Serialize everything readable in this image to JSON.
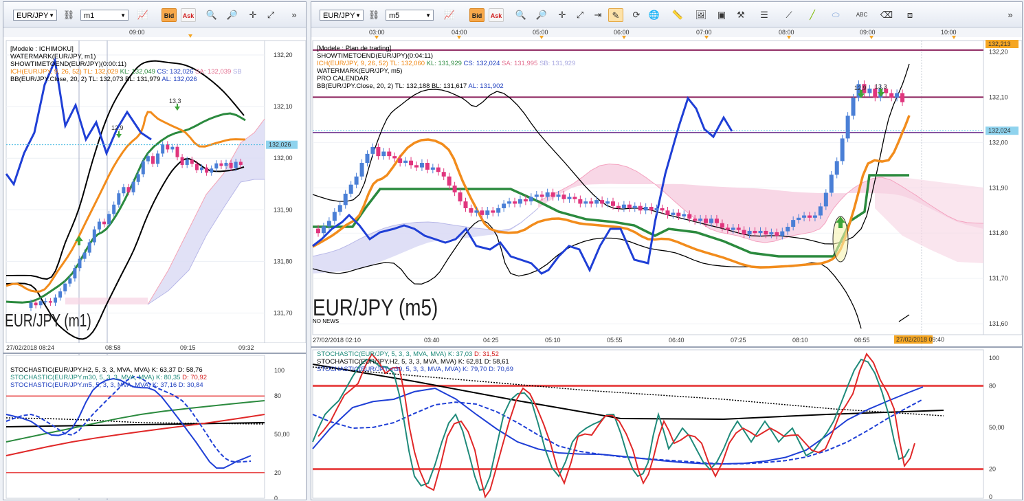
{
  "left": {
    "toolbar": {
      "symbol": "EUR/JPY",
      "timeframe": "m1",
      "bid_label": "Bid",
      "ask_label": "Ask"
    },
    "top_time_labels": [
      "09:00"
    ],
    "legend": [
      {
        "text": "[Modele : ICHIMOKU]",
        "color": "#000000"
      },
      {
        "text": "WATERMARK(EUR/JPY, m1)",
        "color": "#000000"
      },
      {
        "text": "SHOWTIMETOEND(EUR/JPY)(0:00:11)",
        "color": "#000000"
      },
      {
        "text": "ICH(EUR/JPY, 9, 26, 52)  TL: 132,029",
        "color": "#f0850f"
      },
      {
        "text": "KL: 132,049",
        "color": "#2b8a3e"
      },
      {
        "text": "CS: 132,026",
        "color": "#1f3fbf"
      },
      {
        "text": "SA: 132,039",
        "color": "#e26d8e"
      },
      {
        "text": "SB",
        "color": "#a8a8e0"
      },
      {
        "text": "BB(EUR/JPY.Close, 20, 2)  TL: 132,073  BL: 131,979",
        "color": "#000000"
      },
      {
        "text": "AL: 132,026",
        "color": "#1f3fbf"
      }
    ],
    "price_labels": [
      "132,20",
      "132,10",
      "132,00",
      "131,90",
      "131,80",
      "131,70"
    ],
    "current_price": "132,026",
    "watermark": "EUR/JPY (m1)",
    "time_labels": [
      "27/02/2018 08:24",
      "08:58",
      "09:15",
      "09:32"
    ],
    "annotations": [
      "12,9",
      "13,3"
    ],
    "stoch_legend": [
      {
        "text": "STOCHASTIC(EUR/JPY.H2, 5, 3, 3, MVA, MVA)  K: 63,37  D: 58,76",
        "color": "#000000"
      },
      {
        "text": "STOCHASTIC(EUR/JPY.m30, 5, 3, 3, MVA, MVA)  K: 80,35",
        "color": "#1f8a7a"
      },
      {
        "text": "D: 70,92",
        "color": "#d42020"
      },
      {
        "text": "STOCHASTIC(EUR/JPY.m5, 5, 3, 3, MVA, MVA)  K: 37,16  D: 30,84",
        "color": "#1f3fbf"
      }
    ],
    "stoch_levels": [
      "100",
      "80",
      "50,00",
      "20",
      "0"
    ]
  },
  "right": {
    "toolbar": {
      "symbol": "EUR/JPY",
      "timeframe": "m5",
      "bid_label": "Bid",
      "ask_label": "Ask"
    },
    "top_time_labels": [
      "03:00",
      "04:00",
      "05:00",
      "06:00",
      "07:00",
      "08:00",
      "09:00",
      "10:00"
    ],
    "legend": [
      {
        "text": "[Modele : Plan de trading]",
        "color": "#000000"
      },
      {
        "text": "SHOWTIMETOEND(EUR/JPY)(0:04:11)",
        "color": "#000000"
      },
      {
        "text": "ICH(EUR/JPY, 9, 26, 52)  TL: 132,060",
        "color": "#f0850f"
      },
      {
        "text": "KL: 131,929",
        "color": "#2b8a3e"
      },
      {
        "text": "CS: 132,024",
        "color": "#1f3fbf"
      },
      {
        "text": "SA: 131,995",
        "color": "#e26d8e"
      },
      {
        "text": "SB: 131,929",
        "color": "#a8a8e0"
      },
      {
        "text": "WATERMARK(EUR/JPY, m5)",
        "color": "#000000"
      },
      {
        "text": "PRO CALENDAR",
        "color": "#000000"
      },
      {
        "text": "BB(EUR/JPY.Close, 20, 2)  TL: 132,188  BL: 131,617",
        "color": "#000000"
      },
      {
        "text": "AL: 131,902",
        "color": "#1f3fbf"
      }
    ],
    "price_labels": [
      "132,20",
      "132,10",
      "132,00",
      "131,90",
      "131,80",
      "131,70",
      "131,60"
    ],
    "top_price": "132,213",
    "current_price": "132,024",
    "watermark": "EUR/JPY (m5)",
    "no_news": "NO NEWS",
    "time_labels": [
      "27/02/2018 02:10",
      "03:40",
      "04:25",
      "05:10",
      "05:55",
      "06:40",
      "07:25",
      "08:10",
      "08:55"
    ],
    "current_time": "27/02/2018 09:40",
    "annotations": [
      "12,9",
      "13,3"
    ],
    "stoch_legend": [
      {
        "text": "STOCHASTIC(EUR/JPY, 5, 3, 3, MVA, MVA)  K: 37,03",
        "color": "#1f8a7a"
      },
      {
        "text": "D: 31,52",
        "color": "#d42020"
      },
      {
        "text": "STOCHASTIC(EUR/JPY.H2, 5, 3, 3, MVA, MVA)  K: 62,81  D: 58,61",
        "color": "#000000"
      },
      {
        "text": "STOCHASTIC(EUR/JPY.m30, 5, 3, 3, MVA, MVA)  K: 79,70  D: 70,69",
        "color": "#1f3fbf"
      }
    ],
    "stoch_levels": [
      "100",
      "80",
      "50,00",
      "20",
      "0"
    ]
  },
  "colors": {
    "bull": "#4a7fd6",
    "bear": "#e0357d",
    "tenkan": "#f28c1c",
    "kijun": "#2b8a3e",
    "chikou": "#1f3fd6",
    "cloud_pink": "#f7d3e3",
    "cloud_lav": "#dcdcf5",
    "accent": "#f5a623"
  }
}
